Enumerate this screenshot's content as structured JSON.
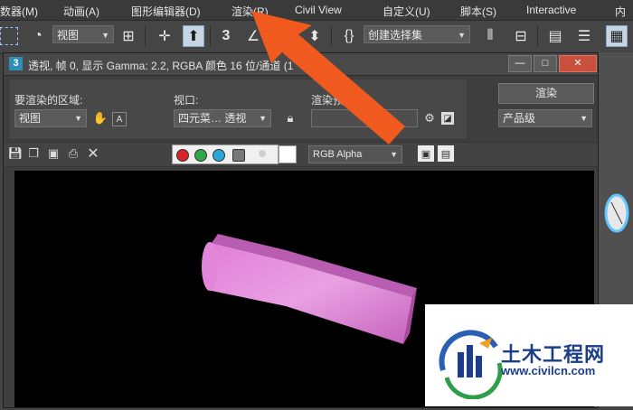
{
  "menu": {
    "items": [
      "数器(M)",
      "动画(A)",
      "图形编辑器(D)",
      "渲染(R)",
      "Civil View",
      "自定义(U)",
      "脚本(S)",
      "Interactive",
      "内"
    ]
  },
  "toolbar": {
    "view_combo": "视图",
    "selection_set_combo": "创建选择集"
  },
  "render_window": {
    "title": "透视, 帧 0, 显示 Gamma: 2.2, RGBA 颜色 16 位/通道 (1",
    "badge": "3",
    "area_label": "要渲染的区域:",
    "area_value": "视图",
    "viewport_label": "视口:",
    "viewport_value": "四元菜… 透视",
    "preset_label": "渲染预设:",
    "render_button": "渲染",
    "quality_value": "产品级",
    "channel_combo": "RGB Alpha"
  },
  "watermark": {
    "title": "土木工程网",
    "url": "www.civilcn.com"
  },
  "colors": {
    "annotation_arrow": "#f05a1e",
    "object": "#d070c8",
    "dot_red": "#d9252a",
    "dot_green": "#2ea84a",
    "dot_blue": "#2aa7d8",
    "brand_blue": "#1b3d8a"
  }
}
